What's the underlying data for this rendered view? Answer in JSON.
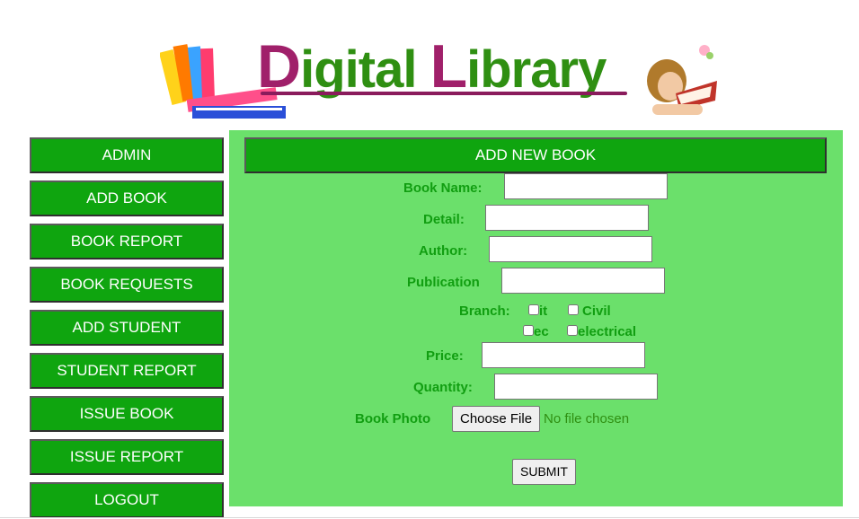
{
  "banner": {
    "logo_letter_d": "D",
    "logo_word_1_rest": "igital",
    "logo_letter_l": "L",
    "logo_word_2_rest": "ibrary",
    "brand_colors": {
      "letters": "#a0206a",
      "text": "#2f8f12"
    }
  },
  "sidebar": {
    "items": [
      {
        "label": "ADMIN"
      },
      {
        "label": "ADD BOOK"
      },
      {
        "label": "BOOK REPORT"
      },
      {
        "label": "BOOK REQUESTS"
      },
      {
        "label": "ADD STUDENT"
      },
      {
        "label": "STUDENT REPORT"
      },
      {
        "label": "ISSUE BOOK"
      },
      {
        "label": "ISSUE REPORT"
      },
      {
        "label": "LOGOUT"
      }
    ]
  },
  "form": {
    "title": "ADD NEW BOOK",
    "book_name_label": "Book Name:",
    "book_name_value": "",
    "detail_label": "Detail:",
    "detail_value": "",
    "author_label": "Author:",
    "author_value": "",
    "publication_label": "Publication",
    "publication_value": "",
    "branch_label": "Branch:",
    "branches": [
      {
        "label": "it",
        "checked": false
      },
      {
        "label": "Civil",
        "checked": false
      },
      {
        "label": "ec",
        "checked": false
      },
      {
        "label": "electrical",
        "checked": false
      }
    ],
    "price_label": "Price:",
    "price_value": "",
    "quantity_label": "Quantity:",
    "quantity_value": "",
    "photo_label": "Book Photo",
    "file_button_label": "Choose File",
    "file_status": "No file chosen",
    "submit_label": "SUBMIT"
  },
  "colors": {
    "button_green": "#0fa50f",
    "panel_green": "#6be06b",
    "label_green": "#119e11"
  }
}
